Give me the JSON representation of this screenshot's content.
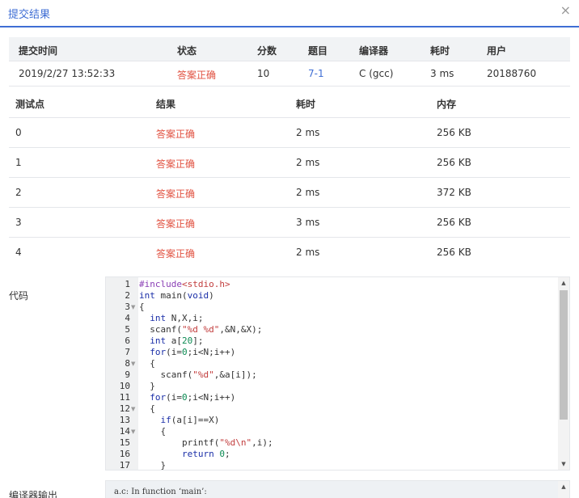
{
  "dialog": {
    "title": "提交结果",
    "close_glyph": "×"
  },
  "submission": {
    "headers": [
      "提交时间",
      "状态",
      "分数",
      "题目",
      "编译器",
      "耗时",
      "用户"
    ],
    "row": {
      "time": "2019/2/27 13:52:33",
      "status": "答案正确",
      "score": "10",
      "problem": "7-1",
      "compiler": "C (gcc)",
      "elapsed": "3 ms",
      "user": "20188760"
    }
  },
  "tests": {
    "headers": [
      "测试点",
      "结果",
      "耗时",
      "内存"
    ],
    "rows": [
      {
        "id": "0",
        "result": "答案正确",
        "time": "2 ms",
        "memory": "256 KB"
      },
      {
        "id": "1",
        "result": "答案正确",
        "time": "2 ms",
        "memory": "256 KB"
      },
      {
        "id": "2",
        "result": "答案正确",
        "time": "2 ms",
        "memory": "372 KB"
      },
      {
        "id": "3",
        "result": "答案正确",
        "time": "3 ms",
        "memory": "256 KB"
      },
      {
        "id": "4",
        "result": "答案正确",
        "time": "2 ms",
        "memory": "256 KB"
      }
    ]
  },
  "code": {
    "label": "代码",
    "lines": [
      {
        "n": "1",
        "fold": false,
        "html": "<span class=\"pp\">#include</span><span class=\"str\">&lt;stdio.h&gt;</span>"
      },
      {
        "n": "2",
        "fold": false,
        "html": "<span class=\"kw\">int</span> main(<span class=\"kw\">void</span>)"
      },
      {
        "n": "3",
        "fold": true,
        "html": "{"
      },
      {
        "n": "4",
        "fold": false,
        "html": "  <span class=\"kw\">int</span> N,X,i;"
      },
      {
        "n": "5",
        "fold": false,
        "html": "  scanf(<span class=\"str\">\"%d %d\"</span>,&amp;N,&amp;X);"
      },
      {
        "n": "6",
        "fold": false,
        "html": "  <span class=\"kw\">int</span> a[<span class=\"num\">20</span>];"
      },
      {
        "n": "7",
        "fold": false,
        "html": "  <span class=\"kw\">for</span>(i=<span class=\"num\">0</span>;i&lt;N;i++)"
      },
      {
        "n": "8",
        "fold": true,
        "html": "  {"
      },
      {
        "n": "9",
        "fold": false,
        "html": "    scanf(<span class=\"str\">\"%d\"</span>,&amp;a[i]);"
      },
      {
        "n": "10",
        "fold": false,
        "html": "  }"
      },
      {
        "n": "11",
        "fold": false,
        "html": "  <span class=\"kw\">for</span>(i=<span class=\"num\">0</span>;i&lt;N;i++)"
      },
      {
        "n": "12",
        "fold": true,
        "html": "  {"
      },
      {
        "n": "13",
        "fold": false,
        "html": "    <span class=\"kw\">if</span>(a[i]==X)"
      },
      {
        "n": "14",
        "fold": true,
        "html": "    {"
      },
      {
        "n": "15",
        "fold": false,
        "html": "        printf(<span class=\"str\">\"%d\\n\"</span>,i);"
      },
      {
        "n": "16",
        "fold": false,
        "html": "        <span class=\"kw\">return</span> <span class=\"num\">0</span>;"
      },
      {
        "n": "17",
        "fold": false,
        "html": "    }"
      }
    ]
  },
  "compiler_output": {
    "label": "编译器输出",
    "text": "a.c: In function ‘main’:"
  },
  "icons": {
    "close": "close-icon",
    "fold": "fold-arrow-icon",
    "scroll_up": "scroll-up-icon",
    "scroll_down": "scroll-down-icon"
  },
  "colors": {
    "accent": "#3f6ed4",
    "status_ok": "#e15241",
    "header_bg": "#f1f3f5"
  }
}
